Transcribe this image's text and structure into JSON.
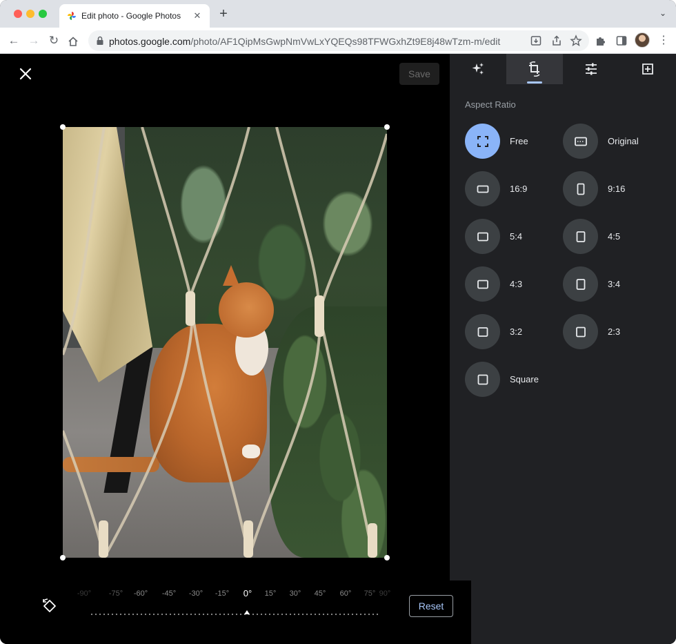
{
  "browser": {
    "tab_title": "Edit photo - Google Photos",
    "url_host": "photos.google.com",
    "url_path": "/photo/AF1QipMsGwpNmVwLxYQEQs98TFWGxhZt9E8j48wTzm-m/edit"
  },
  "editor": {
    "save_label": "Save",
    "reset_label": "Reset",
    "dial": {
      "selected_angle": "0°",
      "labels": [
        "-90°",
        "-75°",
        "-60°",
        "-45°",
        "-30°",
        "-15°",
        "0°",
        "15°",
        "30°",
        "45°",
        "60°",
        "75°",
        "90°"
      ]
    }
  },
  "panel": {
    "tabs": [
      {
        "icon": "auto-enhance-icon",
        "active": false
      },
      {
        "icon": "crop-rotate-icon",
        "active": true
      },
      {
        "icon": "adjust-sliders-icon",
        "active": false
      },
      {
        "icon": "markup-icon",
        "active": false
      }
    ],
    "section_title": "Aspect Ratio",
    "ratios": [
      {
        "label": "Free",
        "icon": "free-crop-icon",
        "active": true
      },
      {
        "label": "Original",
        "icon": "original-ratio-icon",
        "active": false
      },
      {
        "label": "16:9",
        "icon": "landscape-ratio-icon",
        "active": false
      },
      {
        "label": "9:16",
        "icon": "portrait-ratio-icon",
        "active": false
      },
      {
        "label": "5:4",
        "icon": "landscape-ratio-icon",
        "active": false
      },
      {
        "label": "4:5",
        "icon": "portrait-ratio-icon",
        "active": false
      },
      {
        "label": "4:3",
        "icon": "landscape-ratio-icon",
        "active": false
      },
      {
        "label": "3:4",
        "icon": "portrait-ratio-icon",
        "active": false
      },
      {
        "label": "3:2",
        "icon": "landscape-ratio-icon",
        "active": false
      },
      {
        "label": "2:3",
        "icon": "portrait-ratio-icon",
        "active": false
      },
      {
        "label": "Square",
        "icon": "square-ratio-icon",
        "active": false
      }
    ]
  },
  "colors": {
    "accent": "#8ab4f8",
    "panel_bg": "#202124",
    "canvas_bg": "#000000"
  }
}
